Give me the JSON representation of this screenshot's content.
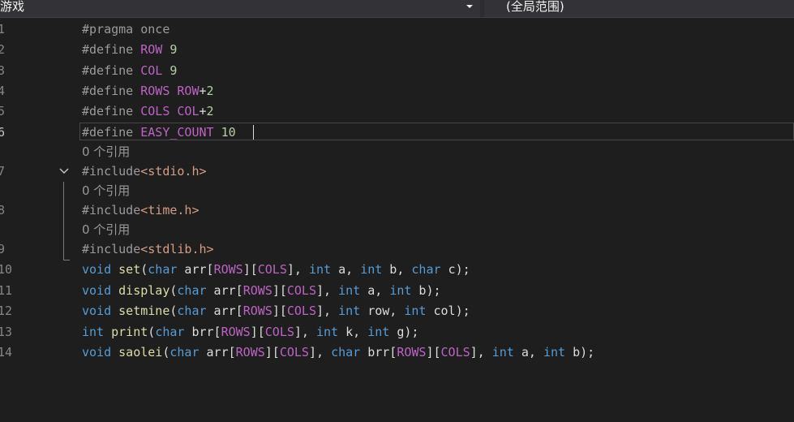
{
  "navigation_bar": {
    "scope_label": "游戏",
    "member_label": "(全局范围)"
  },
  "code_lens_text": "0 个引用",
  "lines": [
    {
      "number": "1",
      "tokens": [
        {
          "t": "#pragma once",
          "c": "pp"
        }
      ]
    },
    {
      "number": "2",
      "tokens": [
        {
          "t": "#define ",
          "c": "pp"
        },
        {
          "t": "ROW",
          "c": "mac"
        },
        {
          "t": " 9",
          "c": "num"
        }
      ]
    },
    {
      "number": "3",
      "tokens": [
        {
          "t": "#define ",
          "c": "pp"
        },
        {
          "t": "COL",
          "c": "mac"
        },
        {
          "t": " 9",
          "c": "num"
        }
      ]
    },
    {
      "number": "4",
      "tokens": [
        {
          "t": "#define ",
          "c": "pp"
        },
        {
          "t": "ROWS",
          "c": "mac"
        },
        {
          "t": " ROW",
          "c": "mac"
        },
        {
          "t": "+",
          "c": ""
        },
        {
          "t": "2",
          "c": "num"
        }
      ]
    },
    {
      "number": "5",
      "tokens": [
        {
          "t": "#define ",
          "c": "pp"
        },
        {
          "t": "COLS",
          "c": "mac"
        },
        {
          "t": " COL",
          "c": "mac"
        },
        {
          "t": "+",
          "c": ""
        },
        {
          "t": "2",
          "c": "num"
        }
      ]
    },
    {
      "number": "6",
      "tokens": [
        {
          "t": "#define ",
          "c": "pp"
        },
        {
          "t": "EASY_COUNT",
          "c": "mac"
        },
        {
          "t": " 10",
          "c": "num"
        }
      ]
    },
    {
      "number": "7",
      "tokens": [
        {
          "t": "#include",
          "c": "pp"
        },
        {
          "t": "<stdio.h>",
          "c": "str"
        }
      ]
    },
    {
      "number": "8",
      "tokens": [
        {
          "t": "#include",
          "c": "pp"
        },
        {
          "t": "<time.h>",
          "c": "str"
        }
      ]
    },
    {
      "number": "9",
      "tokens": [
        {
          "t": "#include",
          "c": "pp"
        },
        {
          "t": "<stdlib.h>",
          "c": "str"
        }
      ]
    },
    {
      "number": "10",
      "tokens": [
        {
          "t": "void",
          "c": "kw"
        },
        {
          "t": " ",
          "c": ""
        },
        {
          "t": "set",
          "c": "fn"
        },
        {
          "t": "(",
          "c": ""
        },
        {
          "t": "char",
          "c": "kw"
        },
        {
          "t": " arr[",
          "c": ""
        },
        {
          "t": "ROWS",
          "c": "mac"
        },
        {
          "t": "][",
          "c": ""
        },
        {
          "t": "COLS",
          "c": "mac"
        },
        {
          "t": "], ",
          "c": ""
        },
        {
          "t": "int",
          "c": "kw"
        },
        {
          "t": " a, ",
          "c": ""
        },
        {
          "t": "int",
          "c": "kw"
        },
        {
          "t": " b, ",
          "c": ""
        },
        {
          "t": "char",
          "c": "kw"
        },
        {
          "t": " c);",
          "c": ""
        }
      ]
    },
    {
      "number": "11",
      "tokens": [
        {
          "t": "void",
          "c": "kw"
        },
        {
          "t": " ",
          "c": ""
        },
        {
          "t": "display",
          "c": "fn"
        },
        {
          "t": "(",
          "c": ""
        },
        {
          "t": "char",
          "c": "kw"
        },
        {
          "t": " arr[",
          "c": ""
        },
        {
          "t": "ROWS",
          "c": "mac"
        },
        {
          "t": "][",
          "c": ""
        },
        {
          "t": "COLS",
          "c": "mac"
        },
        {
          "t": "], ",
          "c": ""
        },
        {
          "t": "int",
          "c": "kw"
        },
        {
          "t": " a, ",
          "c": ""
        },
        {
          "t": "int",
          "c": "kw"
        },
        {
          "t": " b);",
          "c": ""
        }
      ]
    },
    {
      "number": "12",
      "tokens": [
        {
          "t": "void",
          "c": "kw"
        },
        {
          "t": " ",
          "c": ""
        },
        {
          "t": "setmine",
          "c": "fn"
        },
        {
          "t": "(",
          "c": ""
        },
        {
          "t": "char",
          "c": "kw"
        },
        {
          "t": " arr[",
          "c": ""
        },
        {
          "t": "ROWS",
          "c": "mac"
        },
        {
          "t": "][",
          "c": ""
        },
        {
          "t": "COLS",
          "c": "mac"
        },
        {
          "t": "], ",
          "c": ""
        },
        {
          "t": "int",
          "c": "kw"
        },
        {
          "t": " row, ",
          "c": ""
        },
        {
          "t": "int",
          "c": "kw"
        },
        {
          "t": " col);",
          "c": ""
        }
      ]
    },
    {
      "number": "13",
      "tokens": [
        {
          "t": "int",
          "c": "kw"
        },
        {
          "t": " ",
          "c": ""
        },
        {
          "t": "print",
          "c": "fn"
        },
        {
          "t": "(",
          "c": ""
        },
        {
          "t": "char",
          "c": "kw"
        },
        {
          "t": " brr[",
          "c": ""
        },
        {
          "t": "ROWS",
          "c": "mac"
        },
        {
          "t": "][",
          "c": ""
        },
        {
          "t": "COLS",
          "c": "mac"
        },
        {
          "t": "], ",
          "c": ""
        },
        {
          "t": "int",
          "c": "kw"
        },
        {
          "t": " k, ",
          "c": ""
        },
        {
          "t": "int",
          "c": "kw"
        },
        {
          "t": " g);",
          "c": ""
        }
      ]
    },
    {
      "number": "14",
      "tokens": [
        {
          "t": "void",
          "c": "kw"
        },
        {
          "t": " ",
          "c": ""
        },
        {
          "t": "saolei",
          "c": "fn"
        },
        {
          "t": "(",
          "c": ""
        },
        {
          "t": "char",
          "c": "kw"
        },
        {
          "t": " arr[",
          "c": ""
        },
        {
          "t": "ROWS",
          "c": "mac"
        },
        {
          "t": "][",
          "c": ""
        },
        {
          "t": "COLS",
          "c": "mac"
        },
        {
          "t": "], ",
          "c": ""
        },
        {
          "t": "char",
          "c": "kw"
        },
        {
          "t": " brr[",
          "c": ""
        },
        {
          "t": "ROWS",
          "c": "mac"
        },
        {
          "t": "][",
          "c": ""
        },
        {
          "t": "COLS",
          "c": "mac"
        },
        {
          "t": "], ",
          "c": ""
        },
        {
          "t": "int",
          "c": "kw"
        },
        {
          "t": " a, ",
          "c": ""
        },
        {
          "t": "int",
          "c": "kw"
        },
        {
          "t": " b);",
          "c": ""
        }
      ]
    }
  ]
}
